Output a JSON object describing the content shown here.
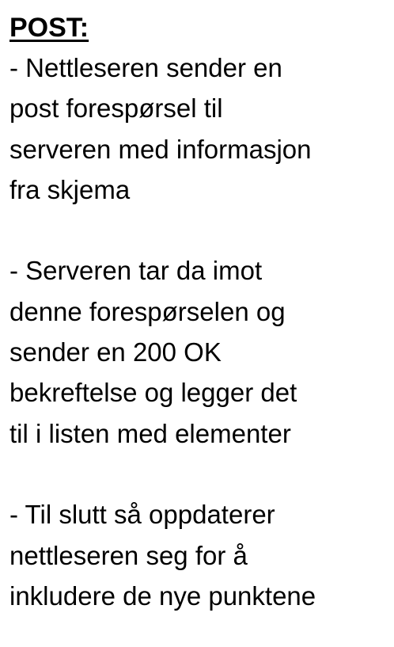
{
  "heading": "POST:",
  "paragraphs": [
    {
      "lines": [
        "- Nettleseren sender en",
        "post forespørsel til",
        "serveren med informasjon",
        "fra skjema"
      ]
    },
    {
      "lines": [
        "- Serveren tar da imot",
        "denne forespørselen og",
        "sender en 200 OK",
        "bekreftelse og legger det",
        "til i listen med elementer"
      ]
    },
    {
      "lines": [
        "- Til slutt så oppdaterer",
        "nettleseren seg for å",
        "inkludere de nye punktene"
      ]
    }
  ]
}
